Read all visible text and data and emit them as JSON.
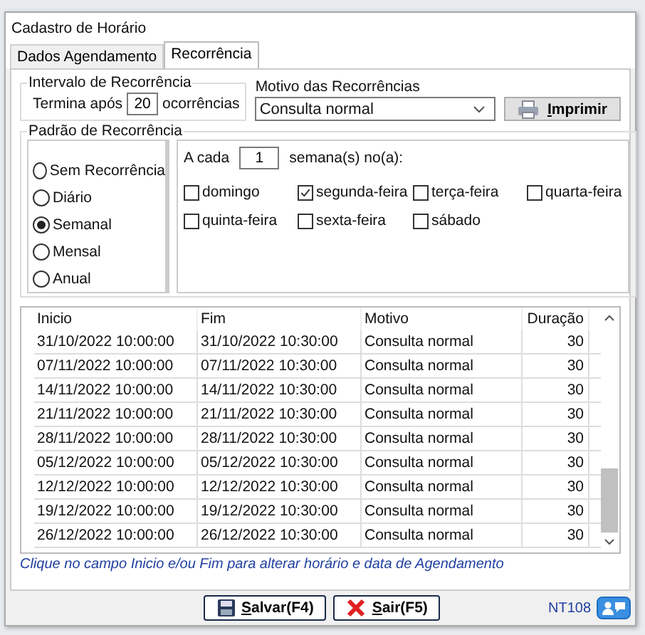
{
  "window": {
    "title": "Cadastro de Horário"
  },
  "tabs": [
    {
      "label": "Dados Agendamento",
      "selected": false
    },
    {
      "label": "Recorrência",
      "selected": true
    }
  ],
  "interval": {
    "title": "Intervalo de Recorrência",
    "label_before": "Termina após",
    "value": "20",
    "label_after": "ocorrências"
  },
  "reason": {
    "label": "Motivo das Recorrências",
    "value": "Consulta normal"
  },
  "print_button": "Imprimir",
  "pattern": {
    "title": "Padrão de Recorrência",
    "options": [
      {
        "label": "Sem Recorrência",
        "selected": false
      },
      {
        "label": "Diário",
        "selected": false
      },
      {
        "label": "Semanal",
        "selected": true
      },
      {
        "label": "Mensal",
        "selected": false
      },
      {
        "label": "Anual",
        "selected": false
      }
    ],
    "every_label": "A cada",
    "every_value": "1",
    "every_unit": "semana(s) no(a):",
    "days": [
      {
        "label": "domingo",
        "checked": false
      },
      {
        "label": "segunda-feira",
        "checked": true
      },
      {
        "label": "terça-feira",
        "checked": false
      },
      {
        "label": "quarta-feira",
        "checked": false
      },
      {
        "label": "quinta-feira",
        "checked": false
      },
      {
        "label": "sexta-feira",
        "checked": false
      },
      {
        "label": "sábado",
        "checked": false
      }
    ]
  },
  "table": {
    "columns": [
      "Inicio",
      "Fim",
      "Motivo",
      "Duração"
    ],
    "rows": [
      [
        "31/10/2022 10:00:00",
        "31/10/2022 10:30:00",
        "Consulta normal",
        "30"
      ],
      [
        "07/11/2022 10:00:00",
        "07/11/2022 10:30:00",
        "Consulta normal",
        "30"
      ],
      [
        "14/11/2022 10:00:00",
        "14/11/2022 10:30:00",
        "Consulta normal",
        "30"
      ],
      [
        "21/11/2022 10:00:00",
        "21/11/2022 10:30:00",
        "Consulta normal",
        "30"
      ],
      [
        "28/11/2022 10:00:00",
        "28/11/2022 10:30:00",
        "Consulta normal",
        "30"
      ],
      [
        "05/12/2022 10:00:00",
        "05/12/2022 10:30:00",
        "Consulta normal",
        "30"
      ],
      [
        "12/12/2022 10:00:00",
        "12/12/2022 10:30:00",
        "Consulta normal",
        "30"
      ],
      [
        "19/12/2022 10:00:00",
        "19/12/2022 10:30:00",
        "Consulta normal",
        "30"
      ],
      [
        "26/12/2022 10:00:00",
        "26/12/2022 10:30:00",
        "Consulta normal",
        "30"
      ]
    ]
  },
  "hint": "Clique no campo Inicio e/ou Fim para alterar horário e data de Agendamento",
  "buttons": [
    {
      "label": "Salvar(F4)",
      "kind": "save"
    },
    {
      "label": "Sair(F5)",
      "kind": "exit"
    }
  ],
  "code": "NT108"
}
